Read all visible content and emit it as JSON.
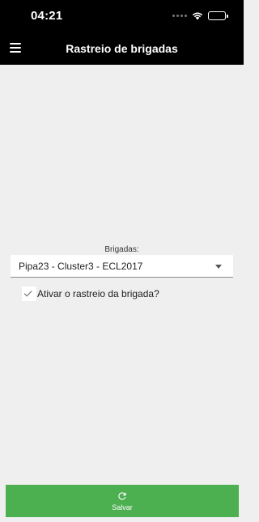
{
  "status_bar": {
    "time": "04:21",
    "icons": [
      "signal-dots-icon",
      "wifi-icon",
      "battery-icon"
    ]
  },
  "app_bar": {
    "title": "Rastreio de brigadas",
    "menu_icon": "menu-icon"
  },
  "form": {
    "brigadas_label": "Brigadas:",
    "brigadas_selected": "Pipa23 - Cluster3 - ECL2017",
    "tracking_checkbox_label": "Ativar o rastreio da brigada?",
    "tracking_checked": true
  },
  "footer": {
    "save_label": "Salvar",
    "save_icon": "refresh-icon"
  },
  "colors": {
    "app_bar": "#000000",
    "background": "#efefef",
    "save_button": "#4caf50"
  }
}
